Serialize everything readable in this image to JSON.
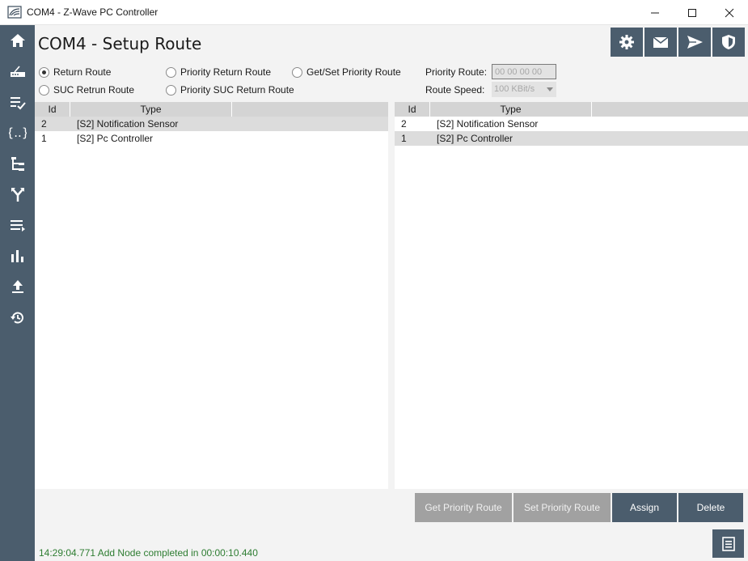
{
  "window": {
    "title": "COM4 - Z-Wave PC Controller",
    "app_icon": "zwave-logo-icon"
  },
  "page": {
    "title": "COM4 - Setup Route"
  },
  "sidebar": {
    "items": [
      {
        "icon": "home-icon"
      },
      {
        "icon": "router-icon"
      },
      {
        "icon": "list-check-icon"
      },
      {
        "icon": "braces-icon"
      },
      {
        "icon": "tree-icon"
      },
      {
        "icon": "route-split-icon"
      },
      {
        "icon": "list-forward-icon"
      },
      {
        "icon": "bar-chart-icon"
      },
      {
        "icon": "upload-icon"
      },
      {
        "icon": "history-icon"
      }
    ]
  },
  "top_actions": [
    {
      "icon": "gear-icon"
    },
    {
      "icon": "mail-icon"
    },
    {
      "icon": "send-icon"
    },
    {
      "icon": "shield-icon"
    }
  ],
  "route_types": {
    "return_route": "Return Route",
    "priority_return_route": "Priority Return Route",
    "get_set_priority_route": "Get/Set Priority Route",
    "suc_return_route": "SUC Retrun Route",
    "priority_suc_return_route": "Priority SUC Return Route",
    "selected": "return_route"
  },
  "priority_route": {
    "label": "Priority Route:",
    "value": "00 00 00 00"
  },
  "route_speed": {
    "label": "Route Speed:",
    "value": "100 KBit/s"
  },
  "left_table": {
    "columns": [
      "Id",
      "Type"
    ],
    "rows": [
      {
        "id": "2",
        "type": "[S2] Notification Sensor",
        "selected": true
      },
      {
        "id": "1",
        "type": "[S2] Pc Controller",
        "selected": false
      }
    ]
  },
  "right_table": {
    "columns": [
      "Id",
      "Type"
    ],
    "rows": [
      {
        "id": "2",
        "type": "[S2] Notification Sensor",
        "selected": false
      },
      {
        "id": "1",
        "type": "[S2] Pc Controller",
        "selected": true
      }
    ]
  },
  "buttons": {
    "get_priority_route": "Get Priority Route",
    "set_priority_route": "Set Priority Route",
    "assign": "Assign",
    "delete": "Delete"
  },
  "status": {
    "message": "14:29:04.771 Add Node completed in 00:00:10.440",
    "color": "#2e7d32"
  },
  "colors": {
    "accent": "#4b5d6d",
    "disabled_button": "#a1a1a1",
    "selected_row": "#dcdcdc",
    "header": "#d4d4d4"
  }
}
